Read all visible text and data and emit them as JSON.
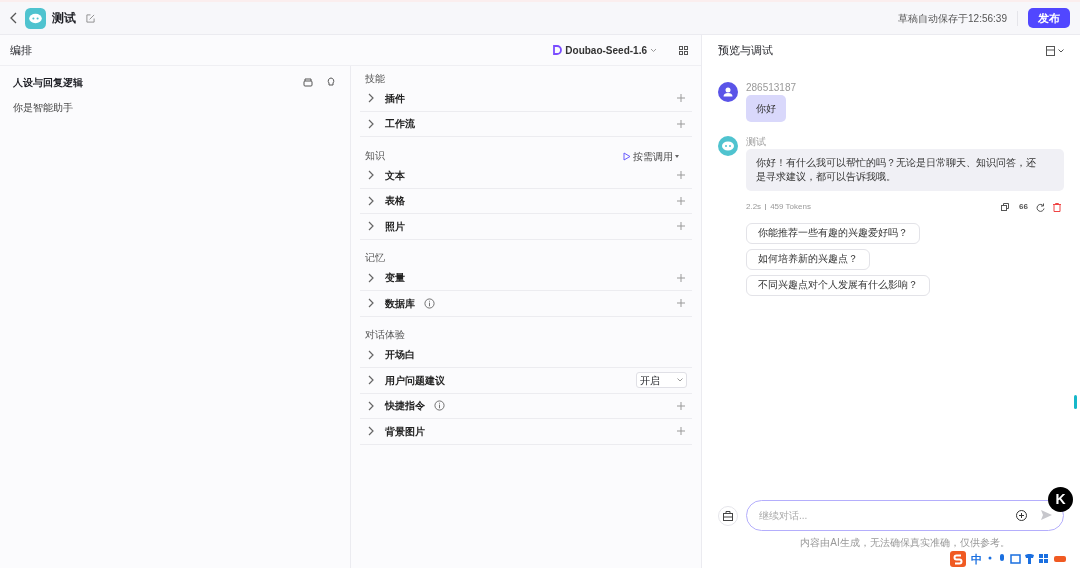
{
  "header": {
    "title": "测试",
    "autosave": "草稿自动保存于12:56:39",
    "publish_button": "发布"
  },
  "arrange": {
    "title": "编排",
    "model": "Doubao-Seed-1.6"
  },
  "persona": {
    "title": "人设与回复逻辑",
    "text": "你是智能助手"
  },
  "sections": [
    {
      "title": "技能",
      "rows": [
        {
          "label": "插件",
          "info": false,
          "kind": "add"
        },
        {
          "label": "工作流",
          "info": false,
          "kind": "add"
        }
      ]
    },
    {
      "title": "知识",
      "action": "按需调用",
      "rows": [
        {
          "label": "文本",
          "info": false,
          "kind": "add"
        },
        {
          "label": "表格",
          "info": false,
          "kind": "add"
        },
        {
          "label": "照片",
          "info": false,
          "kind": "add"
        }
      ]
    },
    {
      "title": "记忆",
      "rows": [
        {
          "label": "变量",
          "info": false,
          "kind": "add"
        },
        {
          "label": "数据库",
          "info": true,
          "kind": "add"
        }
      ]
    },
    {
      "title": "对话体验",
      "rows": [
        {
          "label": "开场白",
          "info": false,
          "kind": "plain"
        },
        {
          "label": "用户问题建议",
          "info": false,
          "kind": "select",
          "value": "开启"
        },
        {
          "label": "快捷指令",
          "info": true,
          "kind": "add"
        },
        {
          "label": "背景图片",
          "info": false,
          "kind": "add"
        }
      ]
    }
  ],
  "preview": {
    "title": "预览与调试",
    "messages": [
      {
        "kind": "user",
        "sender": "286513187",
        "text": "你好"
      },
      {
        "kind": "bot",
        "sender": "测试",
        "text": "你好！有什么我可以帮忙的吗？无论是日常聊天、知识问答，还是寻求建议，都可以告诉我哦。",
        "duration": "2.2s",
        "tokens": "459 Tokens",
        "quote_icon": "66"
      }
    ],
    "suggestions": [
      "你能推荐一些有趣的兴趣爱好吗？",
      "如何培养新的兴趣点？",
      "不同兴趣点对个人发展有什么影响？"
    ],
    "input": {
      "placeholder": "继续对话..."
    },
    "disclaimer": "内容由AI生成，无法确保真实准确，仅供参考。"
  },
  "floating_badge": "K",
  "ime_bar": {
    "mode": "中"
  }
}
